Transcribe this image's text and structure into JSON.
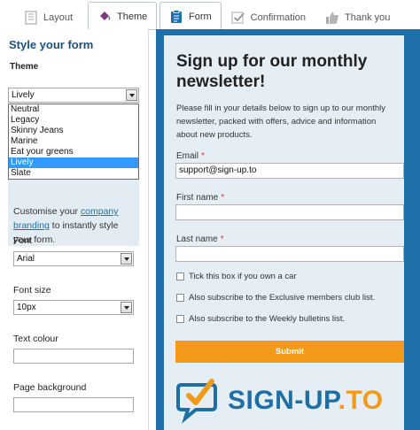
{
  "left_tabs": [
    {
      "label": "Layout",
      "icon": "layout-page-icon"
    },
    {
      "label": "Theme",
      "icon": "paint-bucket-icon"
    }
  ],
  "right_tabs": [
    {
      "label": "Form",
      "icon": "clipboard-form-icon"
    },
    {
      "label": "Confirmation",
      "icon": "checkbox-check-icon"
    },
    {
      "label": "Thank you",
      "icon": "thumbs-up-icon"
    }
  ],
  "theme_panel": {
    "title": "Style your form",
    "theme_label": "Theme",
    "theme_selected": "Lively",
    "theme_options": [
      "Neutral",
      "Legacy",
      "Skinny Jeans",
      "Marine",
      "Eat your greens",
      "Lively",
      "Slate"
    ],
    "info_prefix": "Customise your ",
    "info_link": "company branding",
    "info_suffix": " to instantly style your form.",
    "font_label": "Font",
    "font_value": "Arial",
    "font_size_label": "Font size",
    "font_size_value": "10px",
    "text_colour_label": "Text colour",
    "text_colour_value": "",
    "page_background_label": "Page background",
    "page_background_value": ""
  },
  "form": {
    "title": "Sign up for our monthly newsletter!",
    "intro": "Please fill in your details below to sign up to our monthly newsletter, packed with offers, advice and information about new products.",
    "email_label": "Email",
    "email_value": "support@sign-up.to",
    "first_name_label": "First name",
    "first_name_value": "",
    "last_name_label": "Last name",
    "last_name_value": "",
    "required_marker": "*",
    "checkboxes": [
      "Tick this box if you own a car",
      "Also subscribe to the Exclusive members club list.",
      "Also subscribe to the Weekly bulletins list."
    ],
    "submit_label": "Submit",
    "logo_part1": "SIGN-UP",
    "logo_part2": ".TO"
  },
  "colors": {
    "preview_background": "#1f6fa8",
    "form_card": "#e5eef5",
    "submit": "#f39a1a",
    "panel_title": "#1d4f7c",
    "dropdown_highlight": "#3399ff"
  }
}
